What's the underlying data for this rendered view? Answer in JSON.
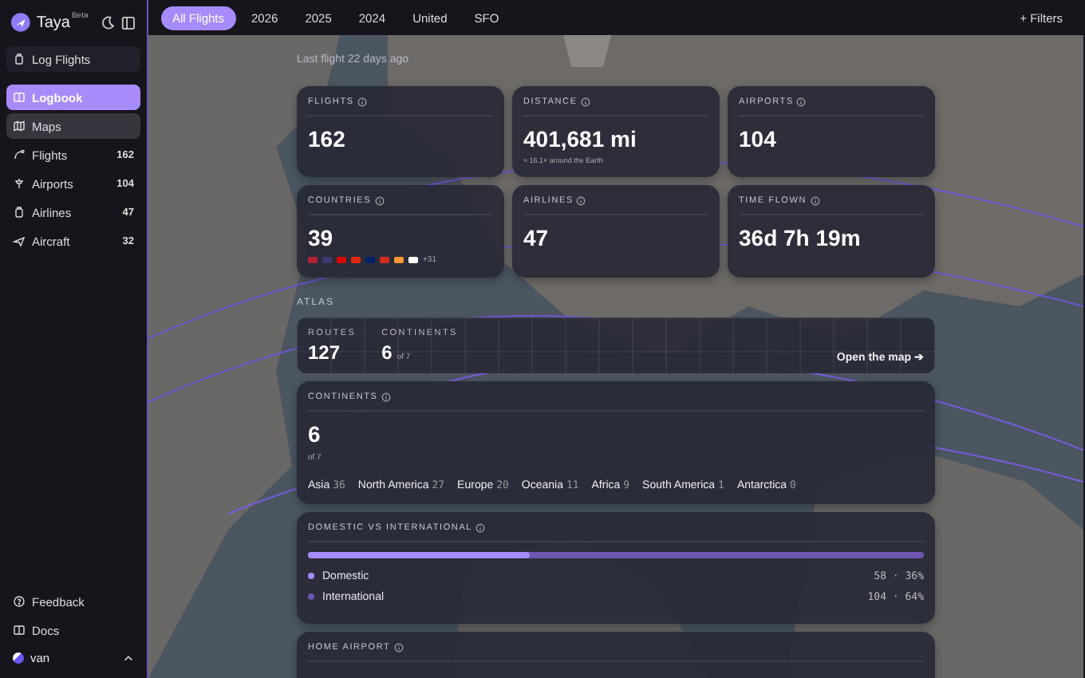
{
  "app": {
    "name": "Taya",
    "badge": "Beta"
  },
  "sidebar": {
    "primary": {
      "label": "Log Flights"
    },
    "items": [
      {
        "label": "Logbook",
        "selected": true,
        "hovered": false
      },
      {
        "label": "Maps",
        "selected": false,
        "hovered": true
      },
      {
        "label": "Flights",
        "count": "162",
        "selected": false,
        "hovered": false
      },
      {
        "label": "Airports",
        "count": "104",
        "selected": false,
        "hovered": false
      },
      {
        "label": "Airlines",
        "count": "47",
        "selected": false,
        "hovered": false
      },
      {
        "label": "Aircraft",
        "count": "32",
        "selected": false,
        "hovered": false
      }
    ],
    "footer": [
      {
        "label": "Feedback"
      },
      {
        "label": "Docs"
      }
    ],
    "user": {
      "name": "van"
    }
  },
  "filters": {
    "chips": [
      {
        "label": "All Flights",
        "selected": true
      },
      {
        "label": "2026",
        "selected": false
      },
      {
        "label": "2025",
        "selected": false
      },
      {
        "label": "2024",
        "selected": false
      },
      {
        "label": "United",
        "selected": false
      },
      {
        "label": "SFO",
        "selected": false
      }
    ],
    "add": "+ Filters"
  },
  "last_flight": "Last flight 22 days ago",
  "stats": [
    {
      "label": "FLIGHTS",
      "value": "162"
    },
    {
      "label": "DISTANCE",
      "value": "401,681 mi",
      "note": "≈ 16.1× around the Earth"
    },
    {
      "label": "AIRPORTS",
      "value": "104"
    },
    {
      "label": "COUNTRIES",
      "value": "39",
      "flags": [
        {
          "color": "#b22234"
        },
        {
          "color": "#3c3b6e"
        },
        {
          "color": "#dd0000"
        },
        {
          "color": "#de2910"
        },
        {
          "color": "#012169"
        },
        {
          "color": "#d52b1e"
        },
        {
          "color": "#ff9933"
        },
        {
          "color": "#ffffff"
        }
      ],
      "more": "+31"
    },
    {
      "label": "AIRLINES",
      "value": "47"
    },
    {
      "label": "TIME FLOWN",
      "value": "36d 7h 19m"
    }
  ],
  "atlas": {
    "heading": "ATLAS",
    "metrics": [
      {
        "label": "ROUTES",
        "value": "127"
      },
      {
        "label": "CONTINENTS",
        "value": "6",
        "suffix": "of 7"
      }
    ],
    "link": "Open the map ➔"
  },
  "continents": {
    "label": "CONTINENTS",
    "value": "6",
    "suffix": "of 7",
    "items": [
      {
        "name": "Asia",
        "count": "36"
      },
      {
        "name": "North America",
        "count": "27"
      },
      {
        "name": "Europe",
        "count": "20"
      },
      {
        "name": "Oceania",
        "count": "11"
      },
      {
        "name": "Africa",
        "count": "9"
      },
      {
        "name": "South America",
        "count": "1"
      },
      {
        "name": "Antarctica",
        "count": "0"
      }
    ]
  },
  "domestic": {
    "label": "DOMESTIC VS INTERNATIONAL",
    "level": 0.36,
    "legend": [
      {
        "name": "Domestic",
        "color": "#a78bfa",
        "reading": "58 · 36%"
      },
      {
        "name": "International",
        "color": "#6d55b0",
        "reading": "104 · 64%"
      }
    ]
  },
  "home_airport": {
    "label": "HOME AIRPORT"
  }
}
